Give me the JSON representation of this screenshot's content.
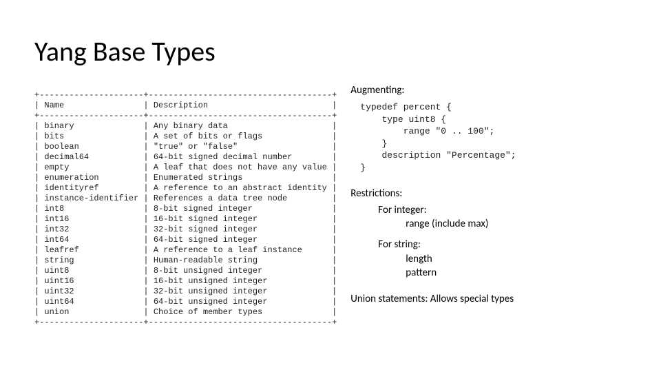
{
  "title": "Yang Base Types",
  "ascii_table": "+---------------------+-------------------------------------+\n| Name                | Description                         |\n+---------------------+-------------------------------------+\n| binary              | Any binary data                     |\n| bits                | A set of bits or flags              |\n| boolean             | \"true\" or \"false\"                   |\n| decimal64           | 64-bit signed decimal number        |\n| empty               | A leaf that does not have any value |\n| enumeration         | Enumerated strings                  |\n| identityref         | A reference to an abstract identity |\n| instance-identifier | References a data tree node         |\n| int8                | 8-bit signed integer                |\n| int16               | 16-bit signed integer               |\n| int32               | 32-bit signed integer               |\n| int64               | 64-bit signed integer               |\n| leafref             | A reference to a leaf instance      |\n| string              | Human-readable string               |\n| uint8               | 8-bit unsigned integer              |\n| uint16              | 16-bit unsigned integer             |\n| uint32              | 32-bit unsigned integer             |\n| uint64              | 64-bit unsigned integer             |\n| union               | Choice of member types              |\n+---------------------+-------------------------------------+",
  "augmenting_label": "Augmenting:",
  "augmenting_code": "typedef percent {\n    type uint8 {\n        range \"0 .. 100\";\n    }\n    description \"Percentage\";\n}",
  "restrictions_label": "Restrictions:",
  "restrictions_int_label": "For integer:",
  "restrictions_int_item": "range (include max)",
  "restrictions_str_label": "For string:",
  "restrictions_str_item1": "length",
  "restrictions_str_item2": "pattern",
  "union_label": "Union statements: Allows special types",
  "chart_data": {
    "type": "table",
    "columns": [
      "Name",
      "Description"
    ],
    "rows": [
      [
        "binary",
        "Any binary data"
      ],
      [
        "bits",
        "A set of bits or flags"
      ],
      [
        "boolean",
        "\"true\" or \"false\""
      ],
      [
        "decimal64",
        "64-bit signed decimal number"
      ],
      [
        "empty",
        "A leaf that does not have any value"
      ],
      [
        "enumeration",
        "Enumerated strings"
      ],
      [
        "identityref",
        "A reference to an abstract identity"
      ],
      [
        "instance-identifier",
        "References a data tree node"
      ],
      [
        "int8",
        "8-bit signed integer"
      ],
      [
        "int16",
        "16-bit signed integer"
      ],
      [
        "int32",
        "32-bit signed integer"
      ],
      [
        "int64",
        "64-bit signed integer"
      ],
      [
        "leafref",
        "A reference to a leaf instance"
      ],
      [
        "string",
        "Human-readable string"
      ],
      [
        "uint8",
        "8-bit unsigned integer"
      ],
      [
        "uint16",
        "16-bit unsigned integer"
      ],
      [
        "uint32",
        "32-bit unsigned integer"
      ],
      [
        "uint64",
        "64-bit unsigned integer"
      ],
      [
        "union",
        "Choice of member types"
      ]
    ]
  }
}
